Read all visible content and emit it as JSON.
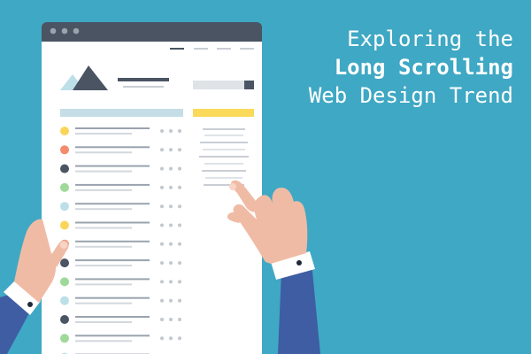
{
  "headline": {
    "line1": "Exploring the",
    "line2": "Long Scrolling",
    "line3": "Web Design Trend"
  },
  "colors": {
    "background": "#3fa8c4",
    "window_chrome": "#4a5463",
    "page": "#ffffff",
    "accent_blue": "#c5dde7",
    "accent_yellow": "#fbd95a",
    "dot_yellow": "#f9d65a",
    "dot_orange": "#f28c6d",
    "dot_navy": "#4a5463",
    "dot_green": "#9fd99a",
    "dot_lightblue": "#bcdfe8",
    "skin": "#f0bba5",
    "sleeve": "#3f5da3",
    "cuff": "#ffffff"
  },
  "icons": [
    "window-dots-icon",
    "mountain-logo-icon",
    "search-icon"
  ],
  "list_dot_colors": [
    "dot_yellow",
    "dot_orange",
    "dot_navy",
    "dot_green",
    "dot_lightblue",
    "dot_yellow",
    "dot_orange",
    "dot_navy",
    "dot_green",
    "dot_lightblue",
    "dot_navy",
    "dot_green",
    "dot_lightblue"
  ]
}
